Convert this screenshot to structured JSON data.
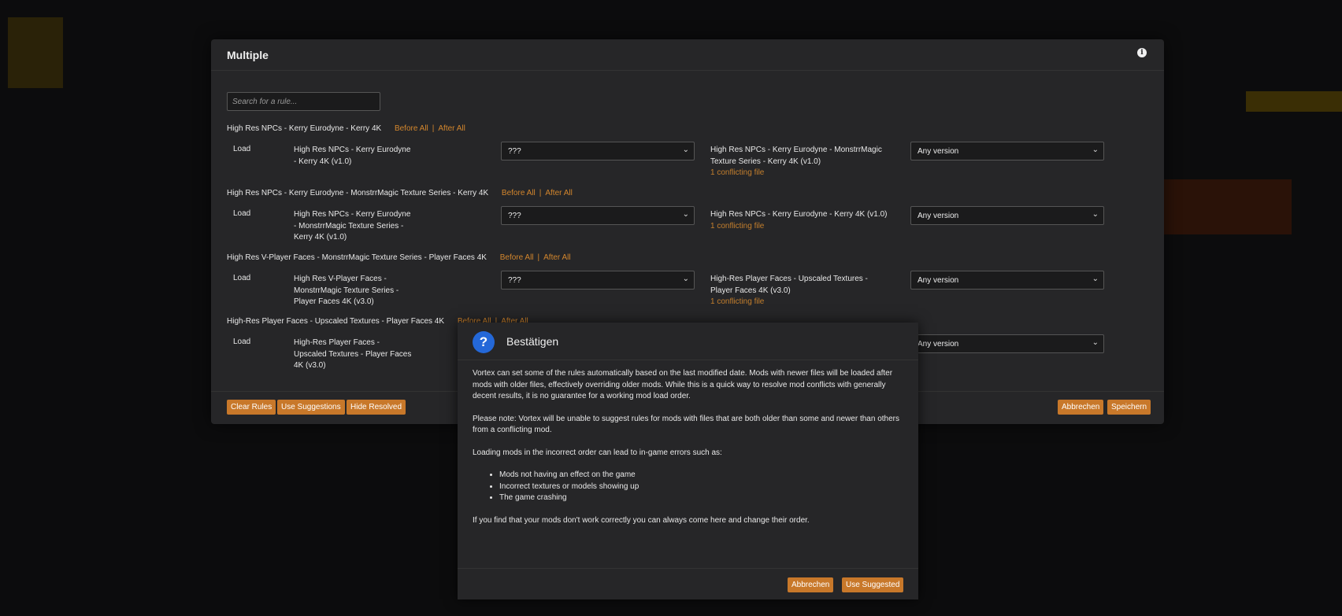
{
  "dialog": {
    "title": "Multiple",
    "search_placeholder": "Search for a rule...",
    "before_all": "Before All",
    "after_all": "After All",
    "load_label": "Load",
    "groups": [
      {
        "title": "High Res NPCs - Kerry Eurodyne - Kerry 4K",
        "mod_a": "High Res NPCs - Kerry Eurodyne - Kerry 4K (v1.0)",
        "relation": "???",
        "mod_b": "High Res NPCs - Kerry Eurodyne - MonstrrMagic Texture Series - Kerry 4K (v1.0)",
        "conflict": "1 conflicting file",
        "version": "Any version"
      },
      {
        "title": "High Res NPCs - Kerry Eurodyne - MonstrrMagic Texture Series - Kerry 4K",
        "mod_a": "High Res NPCs - Kerry Eurodyne - MonstrrMagic Texture Series - Kerry 4K (v1.0)",
        "relation": "???",
        "mod_b": "High Res NPCs - Kerry Eurodyne - Kerry 4K (v1.0)",
        "conflict": "1 conflicting file",
        "version": "Any version"
      },
      {
        "title": "High Res V-Player Faces - MonstrrMagic Texture Series - Player Faces 4K",
        "mod_a": "High Res V-Player Faces - MonstrrMagic Texture Series - Player Faces 4K (v3.0)",
        "relation": "???",
        "mod_b": "High-Res Player Faces - Upscaled Textures - Player Faces 4K (v3.0)",
        "conflict": "1 conflicting file",
        "version": "Any version"
      },
      {
        "title": "High-Res Player Faces - Upscaled Textures - Player Faces 4K",
        "mod_a": "High-Res Player Faces - Upscaled Textures - Player Faces 4K (v3.0)",
        "version": "Any version"
      }
    ],
    "footer": {
      "clear_rules": "Clear Rules",
      "use_suggestions": "Use Suggestions",
      "hide_resolved": "Hide Resolved",
      "cancel": "Abbrechen",
      "save": "Speichern"
    }
  },
  "confirm": {
    "title": "Bestätigen",
    "para1": "Vortex can set some of the rules automatically based on the last modified date. Mods with newer files will be loaded after mods with older files, effectively overriding older mods. While this is a quick way to resolve mod conflicts with generally decent results, it is no guarantee for a working mod load order.",
    "para2": "Please note: Vortex will be unable to suggest rules for mods with files that are both older than some and newer than others from a conflicting mod.",
    "para3": "Loading mods in the incorrect order can lead to in-game errors such as:",
    "bullets": [
      "Mods not having an effect on the game",
      "Incorrect textures or models showing up",
      "The game crashing"
    ],
    "para4": "If you find that your mods don't work correctly you can always come here and change their order.",
    "cancel": "Abbrechen",
    "use_suggested": "Use Suggested"
  }
}
